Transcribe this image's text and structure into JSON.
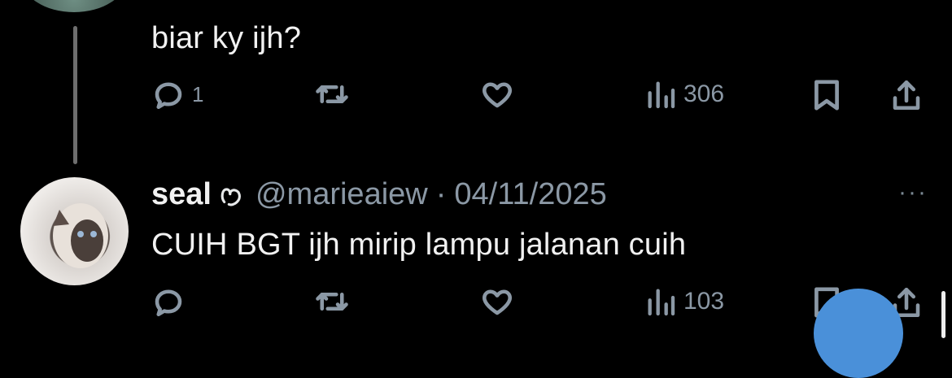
{
  "tweet1": {
    "text": "biar ky ijh?",
    "reply_count": "1",
    "views": "306"
  },
  "tweet2": {
    "display_name": "seal",
    "handle": "@marieaiew",
    "separator": "·",
    "date": "04/11/2025",
    "text": "CUIH BGT ijh mirip lampu jalanan cuih",
    "views": "103",
    "more": "···"
  },
  "icons": {
    "reply": "reply-icon",
    "retweet": "retweet-icon",
    "like": "heart-icon",
    "views": "views-icon",
    "bookmark": "bookmark-icon",
    "share": "share-icon",
    "badge": "heart-outline-icon"
  },
  "colors": {
    "background": "#000000",
    "text": "#e7e9ea",
    "muted": "#8b98a5",
    "fab": "#4a90d9"
  }
}
